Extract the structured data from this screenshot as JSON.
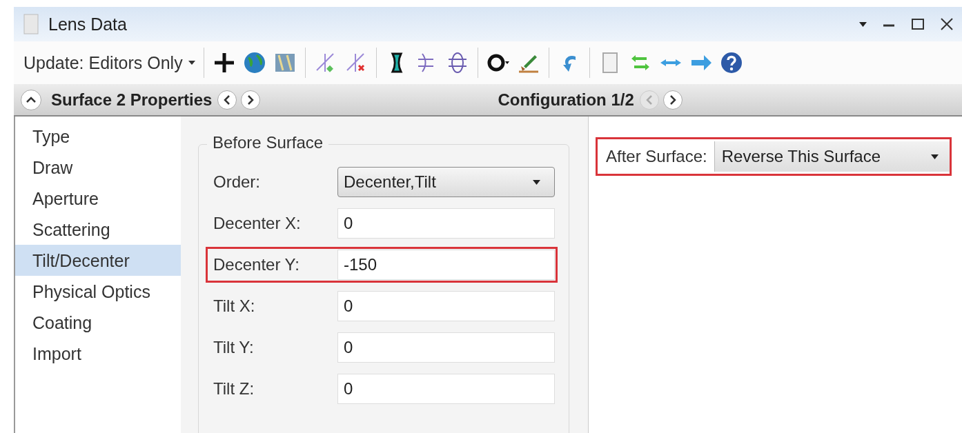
{
  "window": {
    "title": "Lens Data"
  },
  "toolbar": {
    "update_menu": "Update: Editors Only"
  },
  "properties_bar": {
    "title": "Surface 2 Properties",
    "prev_disabled": false,
    "next_disabled": false,
    "configuration": "Configuration 1/2",
    "config_prev_disabled": true,
    "config_next_disabled": false
  },
  "sidebar": {
    "items": [
      {
        "label": "Type",
        "selected": false
      },
      {
        "label": "Draw",
        "selected": false
      },
      {
        "label": "Aperture",
        "selected": false
      },
      {
        "label": "Scattering",
        "selected": false
      },
      {
        "label": "Tilt/Decenter",
        "selected": true
      },
      {
        "label": "Physical Optics",
        "selected": false
      },
      {
        "label": "Coating",
        "selected": false
      },
      {
        "label": "Import",
        "selected": false
      }
    ]
  },
  "before_surface": {
    "title": "Before Surface",
    "rows": [
      {
        "kind": "dropdown",
        "label": "Order:",
        "value": "Decenter,Tilt",
        "highlighted": false
      },
      {
        "kind": "input",
        "label": "Decenter X:",
        "value": "0",
        "highlighted": false
      },
      {
        "kind": "input",
        "label": "Decenter Y:",
        "value": "-150",
        "highlighted": true
      },
      {
        "kind": "input",
        "label": "Tilt X:",
        "value": "0",
        "highlighted": false
      },
      {
        "kind": "input",
        "label": "Tilt Y:",
        "value": "0",
        "highlighted": false
      },
      {
        "kind": "input",
        "label": "Tilt Z:",
        "value": "0",
        "highlighted": false
      }
    ]
  },
  "after_surface": {
    "label": "After Surface:",
    "value": "Reverse This Surface",
    "highlighted": true
  }
}
